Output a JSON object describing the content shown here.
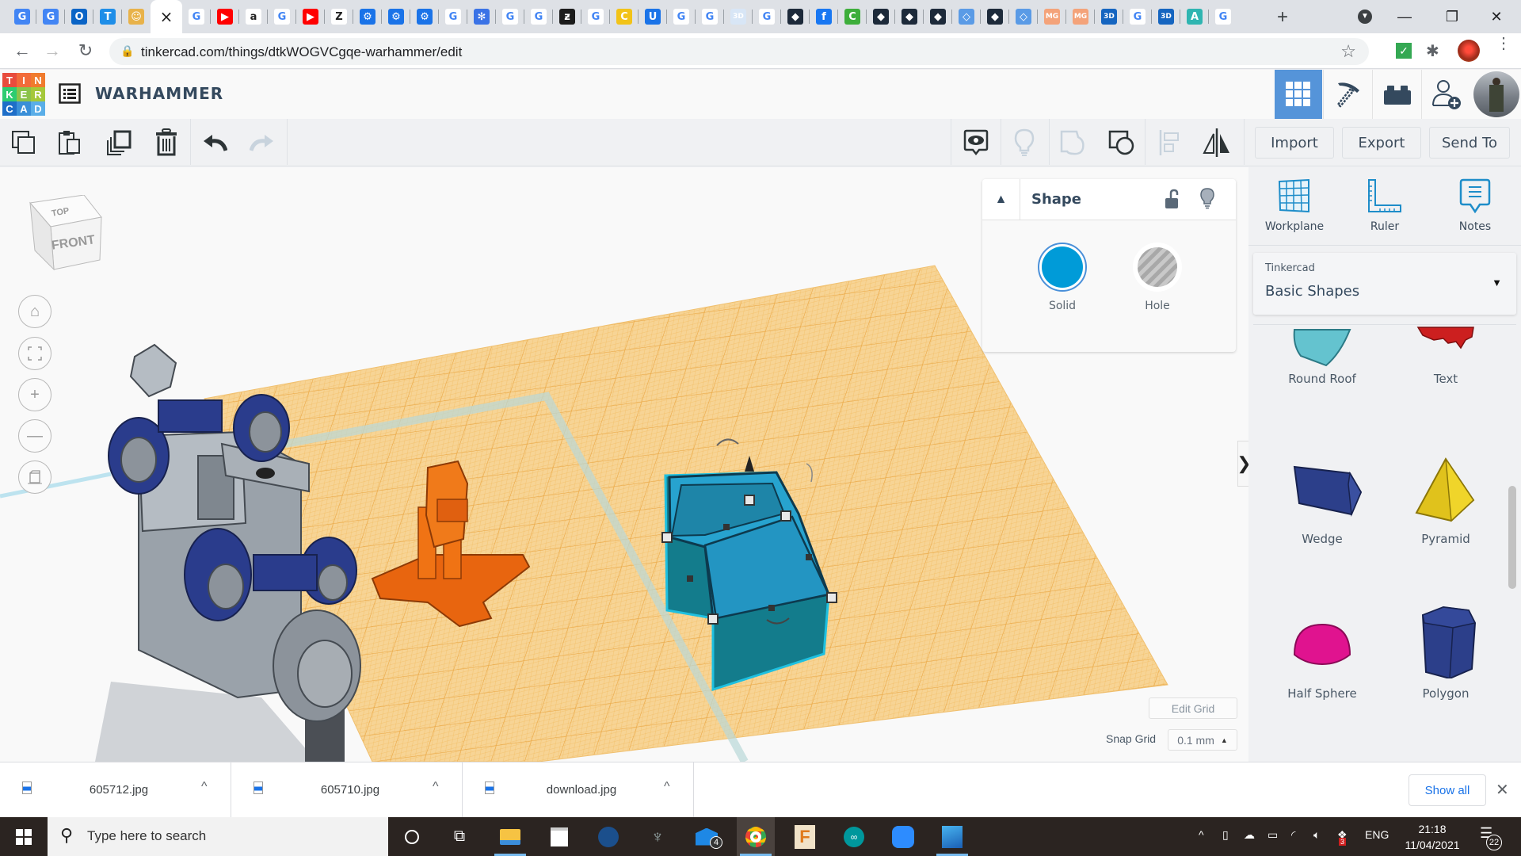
{
  "browser": {
    "tab_favicons": [
      {
        "icon": "google-translate-icon",
        "glyph": "G",
        "bg": "#4285f4"
      },
      {
        "icon": "google-translate-icon",
        "glyph": "G",
        "bg": "#4285f4"
      },
      {
        "icon": "outlook-icon",
        "glyph": "O",
        "bg": "#0a64c6"
      },
      {
        "icon": "t-app-icon",
        "glyph": "T",
        "bg": "#1f8ee8"
      },
      {
        "icon": "character-icon",
        "glyph": "☺",
        "bg": "#e8b24a"
      },
      {
        "icon": "close-icon",
        "glyph": "×",
        "bg": "transparent",
        "active": true
      },
      {
        "icon": "google-icon",
        "glyph": "G",
        "bg": "#ffffff"
      },
      {
        "icon": "youtube-icon",
        "glyph": "▶",
        "bg": "#ff0000"
      },
      {
        "icon": "amazon-icon",
        "glyph": "a",
        "bg": "#ffffff"
      },
      {
        "icon": "google-icon",
        "glyph": "G",
        "bg": "#ffffff"
      },
      {
        "icon": "youtube-icon",
        "glyph": "▶",
        "bg": "#ff0000"
      },
      {
        "icon": "z-icon",
        "glyph": "Z",
        "bg": "#ffffff"
      },
      {
        "icon": "gear-icon",
        "glyph": "⚙",
        "bg": "#1a73e8"
      },
      {
        "icon": "gear-icon",
        "glyph": "⚙",
        "bg": "#1a73e8"
      },
      {
        "icon": "gear-icon",
        "glyph": "⚙",
        "bg": "#1a73e8"
      },
      {
        "icon": "google-icon",
        "glyph": "G",
        "bg": "#ffffff"
      },
      {
        "icon": "snowflake-icon",
        "glyph": "✻",
        "bg": "#3b73e6"
      },
      {
        "icon": "google-icon",
        "glyph": "G",
        "bg": "#ffffff"
      },
      {
        "icon": "google-icon",
        "glyph": "G",
        "bg": "#ffffff"
      },
      {
        "icon": "deviantart-icon",
        "glyph": "ƶ",
        "bg": "#1b1b1b"
      },
      {
        "icon": "google-icon",
        "glyph": "G",
        "bg": "#ffffff"
      },
      {
        "icon": "c-icon",
        "glyph": "C",
        "bg": "#f2c318"
      },
      {
        "icon": "u-icon",
        "glyph": "U",
        "bg": "#1a73e8"
      },
      {
        "icon": "google-icon",
        "glyph": "G",
        "bg": "#ffffff"
      },
      {
        "icon": "google-icon",
        "glyph": "G",
        "bg": "#ffffff"
      },
      {
        "icon": "3d-icon",
        "glyph": "3D",
        "bg": "#d8e6f6"
      },
      {
        "icon": "google-icon",
        "glyph": "G",
        "bg": "#ffffff"
      },
      {
        "icon": "diamond-icon",
        "glyph": "◆",
        "bg": "#1d2a3a"
      },
      {
        "icon": "facebook-icon",
        "glyph": "f",
        "bg": "#1877f2"
      },
      {
        "icon": "c-green-icon",
        "glyph": "C",
        "bg": "#3dae3b"
      },
      {
        "icon": "diamond-icon",
        "glyph": "◆",
        "bg": "#1d2a3a"
      },
      {
        "icon": "diamond-icon",
        "glyph": "◆",
        "bg": "#1d2a3a"
      },
      {
        "icon": "diamond-icon",
        "glyph": "◆",
        "bg": "#1d2a3a"
      },
      {
        "icon": "diamond-outline-icon",
        "glyph": "◇",
        "bg": "#5a9be6"
      },
      {
        "icon": "diamond-icon",
        "glyph": "◆",
        "bg": "#1d2a3a"
      },
      {
        "icon": "diamond-outline-icon",
        "glyph": "◇",
        "bg": "#5a9be6"
      },
      {
        "icon": "mg-icon",
        "glyph": "MG",
        "bg": "#f4a37a"
      },
      {
        "icon": "mg-icon",
        "glyph": "MG",
        "bg": "#f4a37a"
      },
      {
        "icon": "3d-box-icon",
        "glyph": "3D",
        "bg": "#1565c0"
      },
      {
        "icon": "google-icon",
        "glyph": "G",
        "bg": "#ffffff"
      },
      {
        "icon": "3d-box-icon",
        "glyph": "3D",
        "bg": "#1565c0"
      },
      {
        "icon": "autodesk-icon",
        "glyph": "A",
        "bg": "#2fb5b1"
      },
      {
        "icon": "google-icon",
        "glyph": "G",
        "bg": "#ffffff"
      }
    ],
    "url": "tinkercad.com/things/dtkWOGVCgqe-warhammer/edit"
  },
  "app": {
    "logo_letters": [
      "T",
      "I",
      "N",
      "K",
      "E",
      "R",
      "C",
      "A",
      "D"
    ],
    "logo_colors": [
      "#e84c3d",
      "#f26b3a",
      "#f07b2e",
      "#2ecc71",
      "#8bc34a",
      "#a5c83a",
      "#1e6ec8",
      "#3a8fd8",
      "#5aaee8"
    ],
    "title": "WARHAMMER"
  },
  "toolbar": {
    "import_label": "Import",
    "export_label": "Export",
    "sendto_label": "Send To"
  },
  "viewcube": {
    "top": "TOP",
    "front": "FRONT"
  },
  "inspector": {
    "title": "Shape",
    "solid_label": "Solid",
    "hole_label": "Hole",
    "solid_color": "#009bd8"
  },
  "grid": {
    "edit_label": "Edit Grid",
    "snap_label": "Snap Grid",
    "snap_value": "0.1 mm"
  },
  "panel": {
    "tools": [
      {
        "label": "Workplane",
        "icon": "workplane-icon"
      },
      {
        "label": "Ruler",
        "icon": "ruler-icon"
      },
      {
        "label": "Notes",
        "icon": "notes-icon"
      }
    ],
    "library_category": "Tinkercad",
    "library_name": "Basic Shapes",
    "shapes": [
      {
        "label": "Round Roof"
      },
      {
        "label": "Text"
      },
      {
        "label": "Wedge"
      },
      {
        "label": "Pyramid"
      },
      {
        "label": "Half Sphere"
      },
      {
        "label": "Polygon"
      }
    ]
  },
  "downloads": {
    "items": [
      {
        "name": "605712.jpg"
      },
      {
        "name": "605710.jpg"
      },
      {
        "name": "download.jpg"
      }
    ],
    "show_all": "Show all"
  },
  "taskbar": {
    "search_placeholder": "Type here to search",
    "mail_badge": "4",
    "language": "ENG",
    "time": "21:18",
    "date": "11/04/2021",
    "notification_count": "22",
    "tray_badge": "3"
  }
}
